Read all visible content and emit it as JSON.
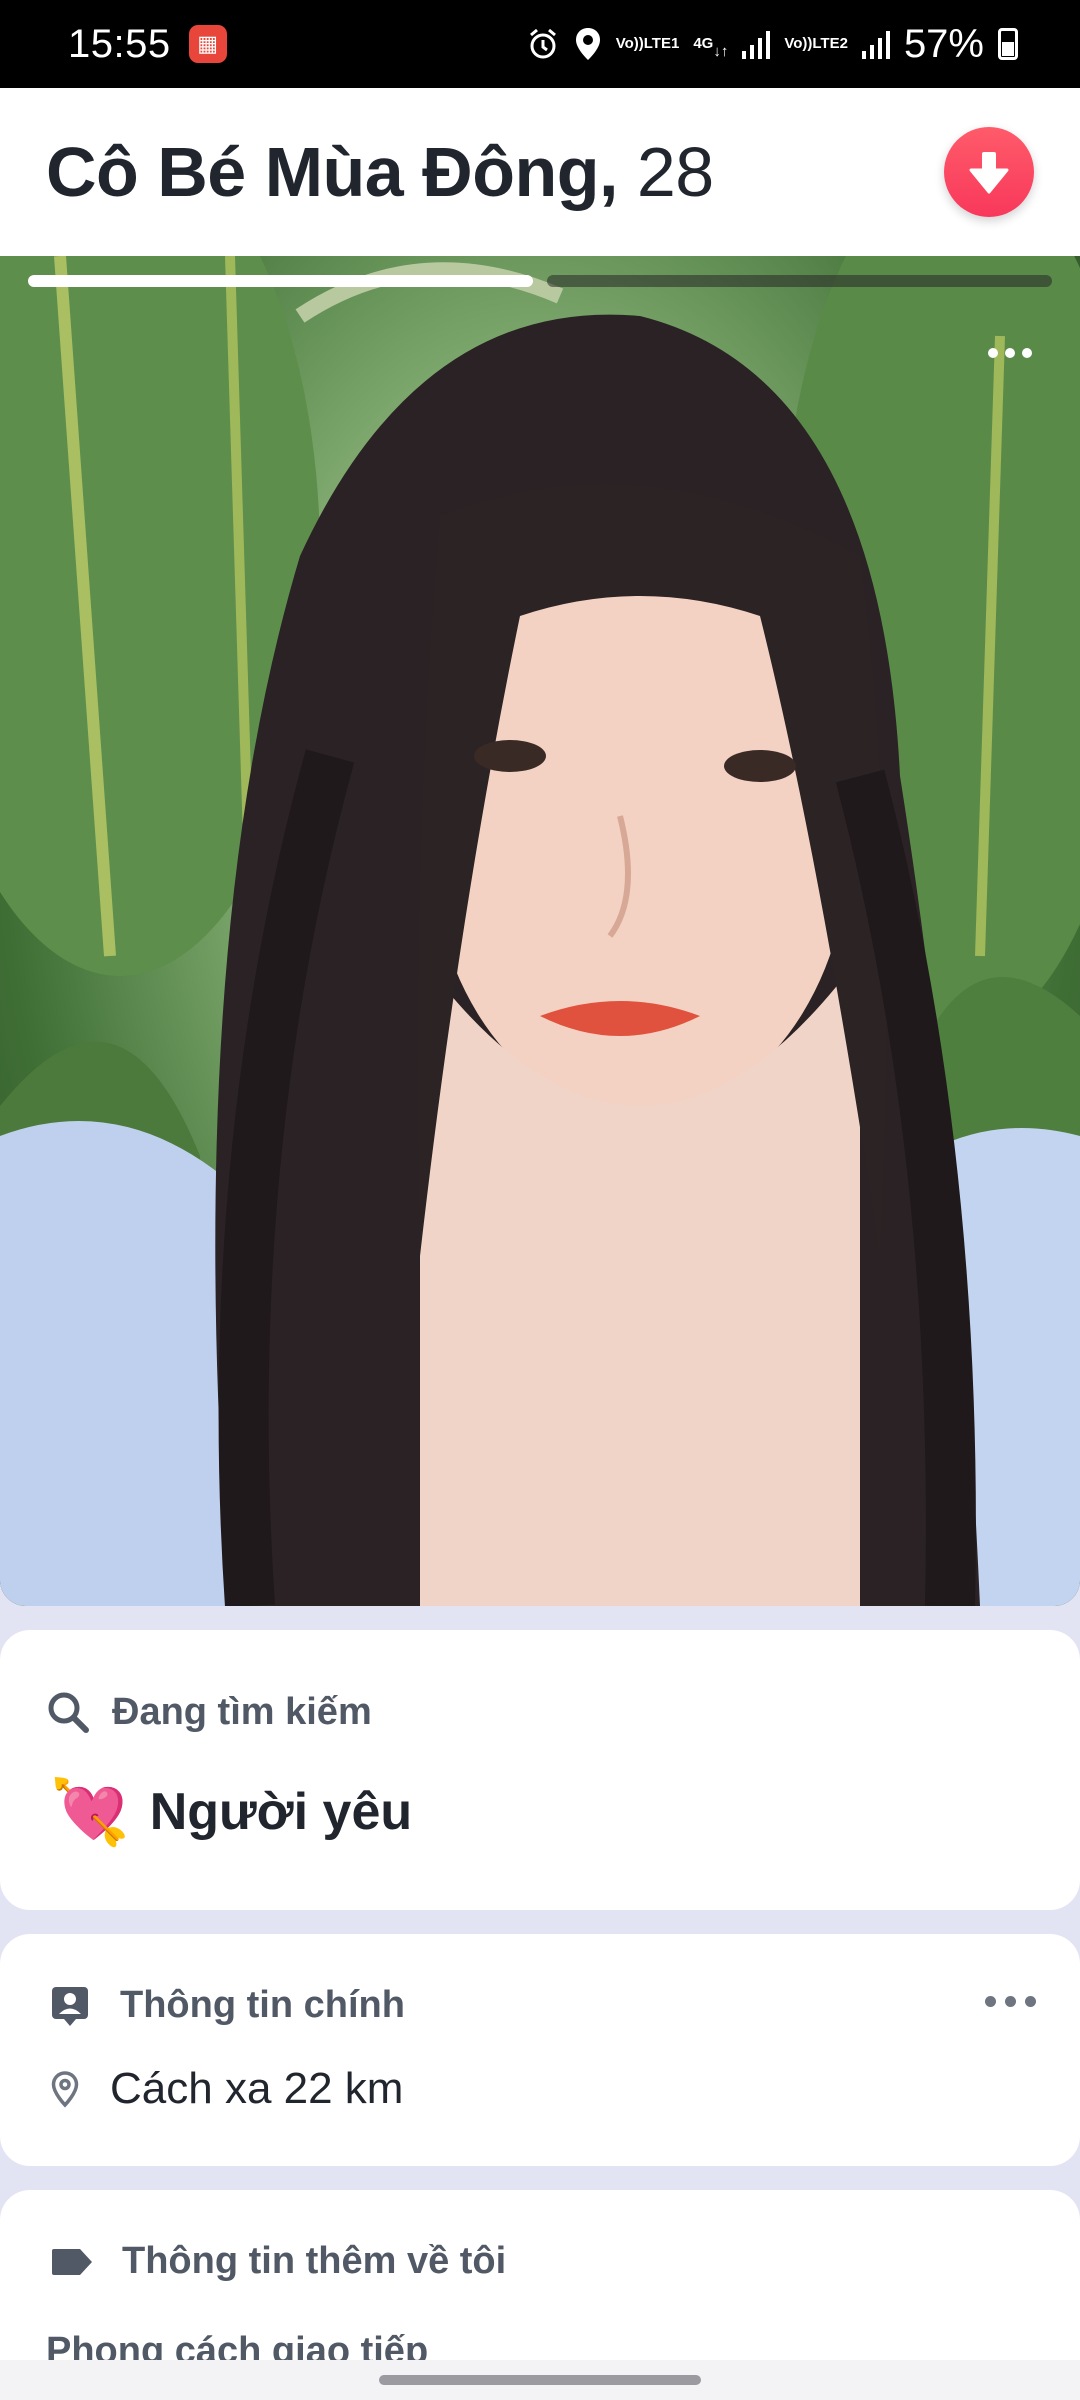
{
  "status_bar": {
    "time": "15:55",
    "battery": "57%",
    "sim1": "LTE1",
    "sim2": "LTE2",
    "network": "4G"
  },
  "profile": {
    "name": "Cô Bé Mùa Đông,",
    "age": "28"
  },
  "photo": {
    "count": 2,
    "current_index": 1
  },
  "looking_for": {
    "label": "Đang tìm kiếm",
    "emoji": "💘",
    "value": "Người yêu"
  },
  "basic_info": {
    "label": "Thông tin chính",
    "distance": "Cách xa 22 km"
  },
  "more_info": {
    "label": "Thông tin thêm về tôi",
    "sub_label": "Phong cách giao tiếp"
  },
  "colors": {
    "accent": "#F8385B",
    "page_bg": "#E2E4F3",
    "label_gray": "#505965"
  },
  "icons": {
    "header_button": "arrow-down-icon",
    "looking_for": "search-icon",
    "basic_info": "id-card-icon",
    "distance": "location-pin-icon",
    "more_info": "tag-icon"
  }
}
